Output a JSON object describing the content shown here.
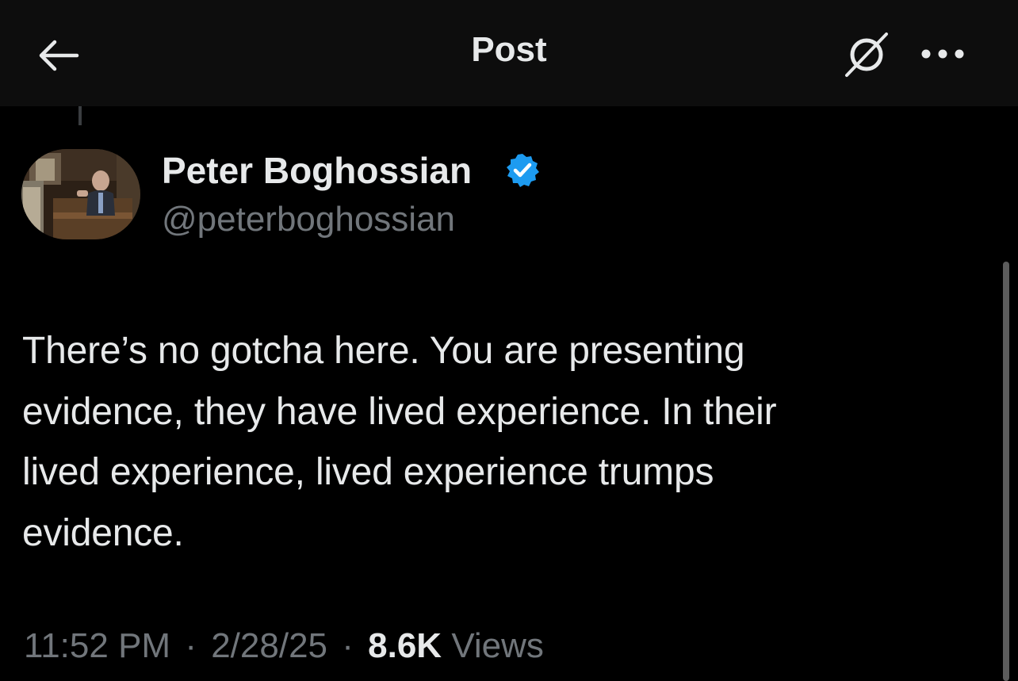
{
  "header": {
    "title": "Post",
    "back_icon": "arrow-left-icon",
    "grok_icon": "grok-icon",
    "more_icon": "more-horizontal-icon"
  },
  "author": {
    "display_name": "Peter Boghossian",
    "handle": "@peterboghossian",
    "verified": true,
    "verified_color": "#1d9bf0"
  },
  "tweet": {
    "text": "There’s no gotcha here. You are presenting\nevidence, they have lived experience. In their\nlived experience, lived experience trumps\nevidence."
  },
  "meta": {
    "time": "11:52 PM",
    "separator": "·",
    "date": "2/28/25",
    "views_count": "8.6K",
    "views_label": "Views"
  },
  "colors": {
    "background": "#000000",
    "header_bg": "#0d0d0d",
    "text_primary": "#e7e9ea",
    "text_secondary": "#71767b"
  }
}
